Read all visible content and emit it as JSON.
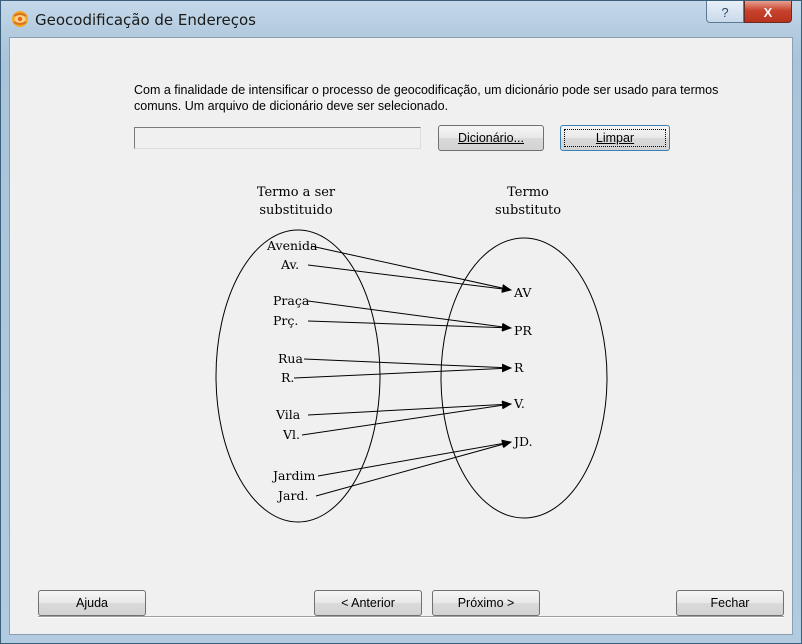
{
  "window": {
    "title": "Geocodificação de Endereços",
    "help_glyph": "?",
    "close_glyph": "X"
  },
  "dictionary": {
    "description": "Com a finalidade de intensificar o processo de geocodificação, um dicionário pode ser usado para termos comuns. Um arquivo de dicionário deve ser selecionado.",
    "file_value": "",
    "browse_label": "Dicionário...",
    "clear_label": "Limpar"
  },
  "diagram": {
    "left_heading": [
      "Termo a ser",
      "substituido"
    ],
    "right_heading": [
      "Termo",
      "substituto"
    ],
    "source_terms": [
      "Avenida",
      "Av.",
      "Praça",
      "Prç.",
      "Rua",
      "R.",
      "Vila",
      "Vl.",
      "Jardim",
      "Jard."
    ],
    "target_terms": [
      "AV",
      "PR",
      "R",
      "V.",
      "JD."
    ],
    "mappings": [
      {
        "from": "Avenida",
        "to": "AV"
      },
      {
        "from": "Av.",
        "to": "AV"
      },
      {
        "from": "Praça",
        "to": "PR"
      },
      {
        "from": "Prç.",
        "to": "PR"
      },
      {
        "from": "Rua",
        "to": "R"
      },
      {
        "from": "R.",
        "to": "R"
      },
      {
        "from": "Vila",
        "to": "V."
      },
      {
        "from": "Vl.",
        "to": "V."
      },
      {
        "from": "Jardim",
        "to": "JD."
      },
      {
        "from": "Jard.",
        "to": "JD."
      }
    ]
  },
  "footer": {
    "help_label": "Ajuda",
    "back_label": "< Anterior",
    "next_label": "Próximo >",
    "close_label": "Fechar"
  }
}
